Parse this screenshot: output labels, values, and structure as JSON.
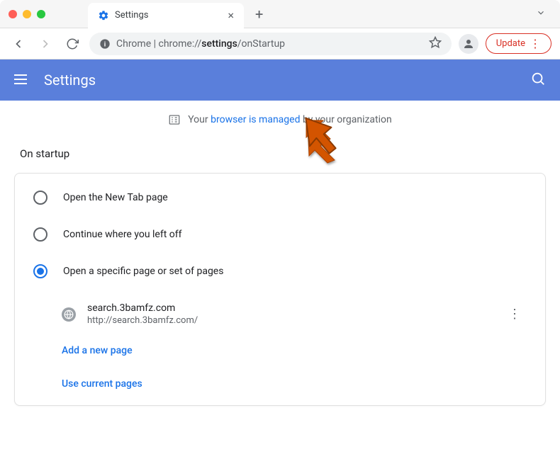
{
  "window": {
    "tab_title": "Settings"
  },
  "toolbar": {
    "host_prefix": "Chrome",
    "url_host": "chrome://",
    "url_path_bold": "settings",
    "url_path_rest": "/onStartup",
    "update_label": "Update"
  },
  "header": {
    "title": "Settings"
  },
  "managed": {
    "prefix": "Your ",
    "link": "browser is managed",
    "suffix": " by your organization"
  },
  "section": {
    "title": "On startup"
  },
  "radios": {
    "new_tab": "Open the New Tab page",
    "continue": "Continue where you left off",
    "specific": "Open a specific page or set of pages"
  },
  "startup_page": {
    "title": "search.3bamfz.com",
    "url": "http://search.3bamfz.com/"
  },
  "links": {
    "add_page": "Add a new page",
    "use_current": "Use current pages"
  }
}
